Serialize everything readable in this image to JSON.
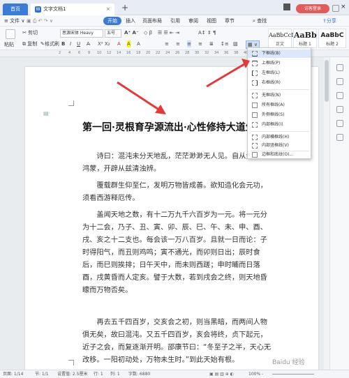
{
  "tabs": {
    "home": "首页",
    "doc": "文字文档1",
    "plus": "+"
  },
  "window": {
    "login": "访客登录"
  },
  "menu": {
    "file": "≡ 文件 ∨",
    "items": [
      "开始",
      "插入",
      "页面布局",
      "引用",
      "审阅",
      "视图",
      "章节"
    ],
    "search": "查找",
    "share": "分享"
  },
  "toolbar": {
    "paste": "粘贴",
    "cut": "剪切",
    "copy": "复制",
    "format_painter": "格式刷",
    "font": "思源宋体 Heavy",
    "size": "五号",
    "styles": [
      {
        "preview": "AaBbCcDd",
        "label": "正文"
      },
      {
        "preview": "AaBb",
        "label": "标题 1"
      },
      {
        "preview": "AaBbC",
        "label": "标题 2"
      }
    ]
  },
  "ruler": [
    "2",
    "4",
    "6",
    "8",
    "10",
    "12",
    "14",
    "16",
    "18",
    "20",
    "22",
    "24",
    "26",
    "28",
    "30",
    "32",
    "34",
    "36",
    "38",
    "40"
  ],
  "document": {
    "title": "第一回·灵根育孕源流出·心性修持大道生",
    "paragraphs": [
      "诗曰：混沌未分天地乱，茫茫渺渺无人见。自从盘古破鸿蒙，开辟从兹清浊辨。",
      "覆载群生仰至仁，发明万物皆成善。欲知造化会元功，须看西游释厄传。",
      "盖闻天地之数，有十二万九千六百岁为一元。将一元分为十二会，乃子、丑、寅、卯、辰、巳、午、未、申、酉、戌、亥之十二支也。每会该一万八百岁。且就一日而论：子时得阳气，而丑则鸡鸣；寅不通光，而卯则日出；辰时食后，而巳则挨排；日午天中，而未则西蹉；申时晡而日落酉，戌黄昏而人定亥。譬于大数，若到戌会之终，则天地昏矇而万物否矣。",
      "再去五千四百岁，交亥会之初，则当黑暗，而两间人物俱无矣，故曰混沌。又五千四百岁，亥会将终，贞下起元，近子之会，而复逐渐开明。邵康节曰：“冬至子之半，天心无改移。一阳初动处，万物未生时。”到此天始有根。"
    ]
  },
  "dropdown": [
    {
      "label": "下框线(B)",
      "icon": "border-bottom-icon"
    },
    {
      "label": "上框线(P)",
      "icon": "border-top-icon"
    },
    {
      "label": "左框线(L)",
      "icon": "border-left-icon"
    },
    {
      "label": "右框线(R)",
      "icon": "border-right-icon"
    },
    {
      "label": "无框线(N)",
      "icon": "border-none-icon"
    },
    {
      "label": "所有框线(A)",
      "icon": "border-all-icon"
    },
    {
      "label": "外侧框线(S)",
      "icon": "border-outside-icon"
    },
    {
      "label": "内部框线(I)",
      "icon": "border-inside-icon"
    },
    {
      "label": "内部横框线(H)",
      "icon": "border-inside-horizontal-icon"
    },
    {
      "label": "内部竖框线(V)",
      "icon": "border-inside-vertical-icon"
    },
    {
      "label": "边框和底纹(O)...",
      "icon": "borders-shading-icon"
    }
  ],
  "status": {
    "page": "页面: 1/14",
    "section": "节: 1/1",
    "setting": "设置值: 2.5厘米",
    "row": "行: 1",
    "col": "列: 1",
    "words": "字数: 6880",
    "zoom": "100% -"
  },
  "watermark": "Baidu 经验",
  "colors": {
    "accent": "#3b7bd8",
    "login": "#e35a5a",
    "arrow": "#e53935"
  }
}
